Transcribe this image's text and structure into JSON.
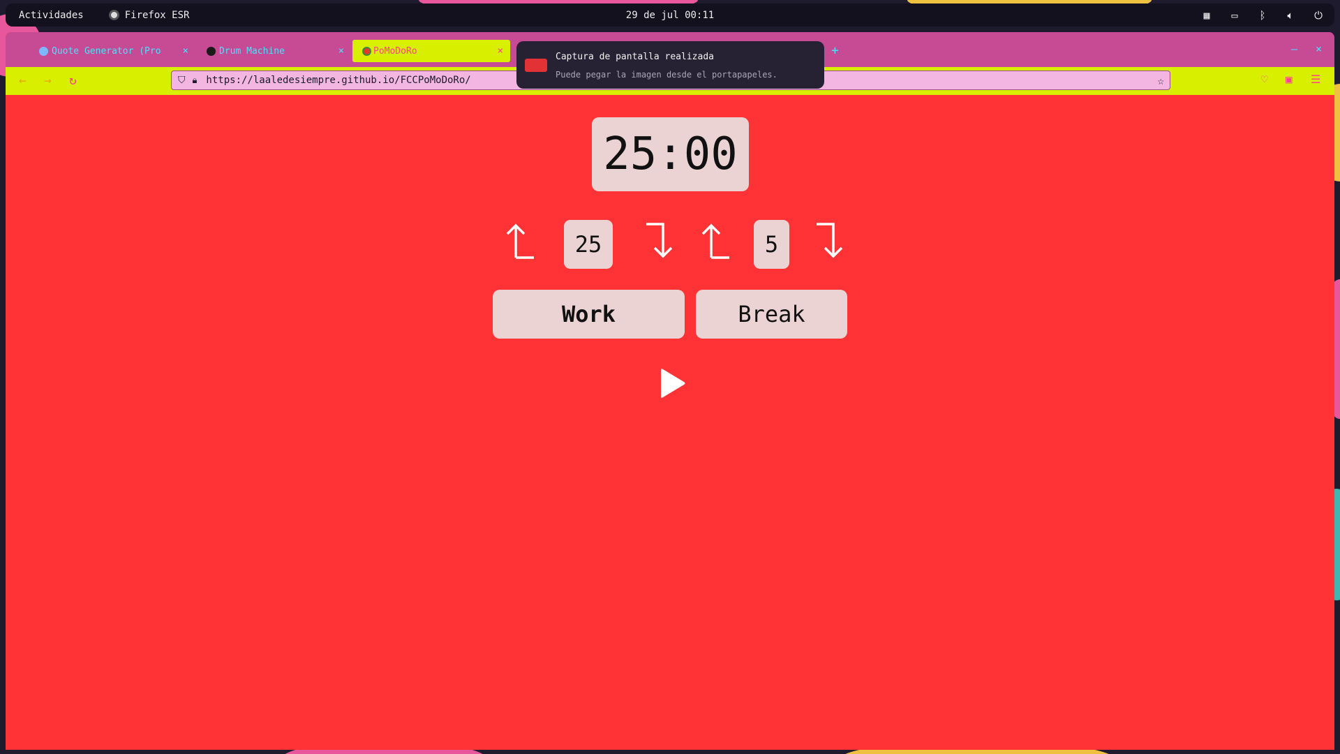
{
  "topbar": {
    "activities": "Actividades",
    "app_name": "Firefox ESR",
    "clock": "29 de jul 00:11"
  },
  "tabs": [
    {
      "label": "Quote Generator (Pro",
      "close": "×",
      "active": false
    },
    {
      "label": "Drum Machine",
      "close": "×",
      "active": false
    },
    {
      "label": "PoMoDoRo",
      "close": "×",
      "active": true
    }
  ],
  "new_tab": "+",
  "window_controls": {
    "minimize": "—",
    "close": "×"
  },
  "navbar": {
    "back": "←",
    "forward": "→",
    "reload": "↻",
    "url": "https://laaledesiempre.github.io/FCCPoMoDoRo/"
  },
  "notification": {
    "title": "Captura de pantalla realizada",
    "body": "Puede pegar la imagen desde el portapapeles."
  },
  "pomodoro": {
    "timer": "25:00",
    "work_length": "25",
    "break_length": "5",
    "work_label": "Work",
    "break_label": "Break",
    "mode": "Work"
  },
  "icons": {
    "increment": "arrow-up-icon",
    "decrement": "arrow-down-icon",
    "play": "play-icon"
  },
  "colors": {
    "background": "#ff3236",
    "panel": "#ecd3d3",
    "toolbar": "#d8f000",
    "tabstrip": "#c74a94"
  }
}
